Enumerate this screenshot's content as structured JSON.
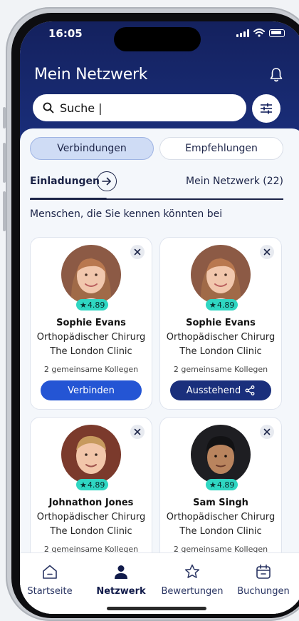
{
  "status_bar": {
    "time": "16:05"
  },
  "header": {
    "title": "Mein Netzwerk"
  },
  "search": {
    "value": "Suche |"
  },
  "segments": {
    "connections": "Verbindungen",
    "recommendations": "Empfehlungen"
  },
  "tabs": {
    "invitations": "Einladungen",
    "my_network": "Mein Netzwerk (22)"
  },
  "section_heading": "Menschen, die Sie kennen könnten bei",
  "cards": [
    {
      "rating": "4.89",
      "name": "Sophie Evans",
      "role": "Orthopädischer Chirurg",
      "clinic": "The London Clinic",
      "mutual": "2 gemeinsame Kollegen",
      "action": "Verbinden"
    },
    {
      "rating": "4.89",
      "name": "Sophie Evans",
      "role": "Orthopädischer Chirurg",
      "clinic": "The London Clinic",
      "mutual": "2 gemeinsame Kollegen",
      "action": "Ausstehend"
    },
    {
      "rating": "4.89",
      "name": "Johnathon Jones",
      "role": "Orthopädischer Chirurg",
      "clinic": "The London Clinic",
      "mutual": "2 gemeinsame Kollegen"
    },
    {
      "rating": "4.89",
      "name": "Sam Singh",
      "role": "Orthopädischer Chirurg",
      "clinic": "The London Clinic",
      "mutual": "2 gemeinsame Kollegen"
    }
  ],
  "nav": {
    "home": "Startseite",
    "network": "Netzwerk",
    "reviews": "Bewertungen",
    "bookings": "Buchungen"
  },
  "colors": {
    "header": "#14215e",
    "primary_button": "#2455d4",
    "pending_button": "#1a2f7c",
    "rating_badge": "#2fd6c2"
  }
}
